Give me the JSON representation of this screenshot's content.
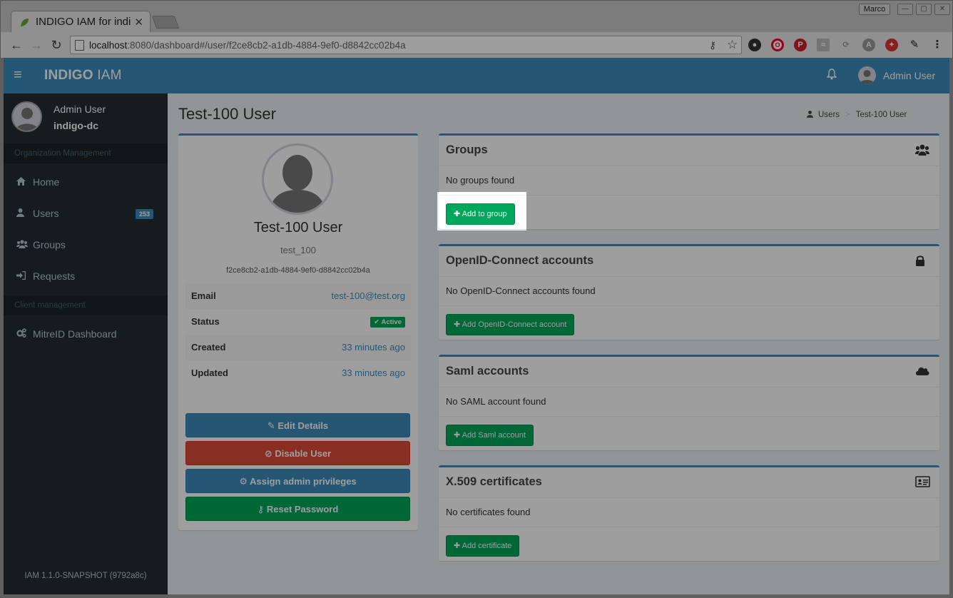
{
  "browser": {
    "tab_title": "INDIGO IAM for indi",
    "url_host": "localhost",
    "url_rest": ":8080/dashboard#/user/f2ce8cb2-a1db-4884-9ef0-d8842cc02b4a",
    "profile_name": "Marco"
  },
  "header": {
    "brand_bold": "INDIGO",
    "brand_light": " IAM",
    "user_name": "Admin User"
  },
  "sidebar": {
    "user_name": "Admin User",
    "user_org": "indigo-dc",
    "section_org": "Organization Management",
    "section_client": "Client management",
    "items": [
      {
        "label": "Home",
        "icon": "home-icon"
      },
      {
        "label": "Users",
        "icon": "user-icon",
        "badge": "253"
      },
      {
        "label": "Groups",
        "icon": "users-icon"
      },
      {
        "label": "Requests",
        "icon": "sign-in-icon"
      },
      {
        "label": "MitreID Dashboard",
        "icon": "cogs-icon"
      }
    ],
    "version": "IAM 1.1.0-SNAPSHOT (9792a8c)"
  },
  "page": {
    "title": "Test-100 User",
    "breadcrumb": [
      "Users",
      "Test-100 User"
    ]
  },
  "profile": {
    "display_name": "Test-100 User",
    "username": "test_100",
    "uuid": "f2ce8cb2-a1db-4884-9ef0-d8842cc02b4a",
    "rows": [
      {
        "key": "Email",
        "value": "test-100@test.org"
      },
      {
        "key": "Status",
        "value": "Active"
      },
      {
        "key": "Created",
        "value": "33 minutes ago"
      },
      {
        "key": "Updated",
        "value": "33 minutes ago"
      }
    ],
    "buttons": {
      "edit": "Edit Details",
      "disable": "Disable User",
      "admin": "Assign admin privileges",
      "reset": "Reset Password"
    }
  },
  "panels": [
    {
      "title": "Groups",
      "empty": "No groups found",
      "button": "Add to group",
      "icon": "users-icon"
    },
    {
      "title": "OpenID-Connect accounts",
      "empty": "No OpenID-Connect accounts found",
      "button": "Add OpenID-Connect account",
      "icon": "lock-icon"
    },
    {
      "title": "Saml accounts",
      "empty": "No SAML account found",
      "button": "Add Saml account",
      "icon": "cloud-icon"
    },
    {
      "title": "X.509 certificates",
      "empty": "No certificates found",
      "button": "Add certificate",
      "icon": "id-card-icon"
    }
  ],
  "colors": {
    "primary": "#3c8dbc",
    "success": "#00a65a",
    "danger": "#dd4b39",
    "sidebar": "#222d32"
  }
}
